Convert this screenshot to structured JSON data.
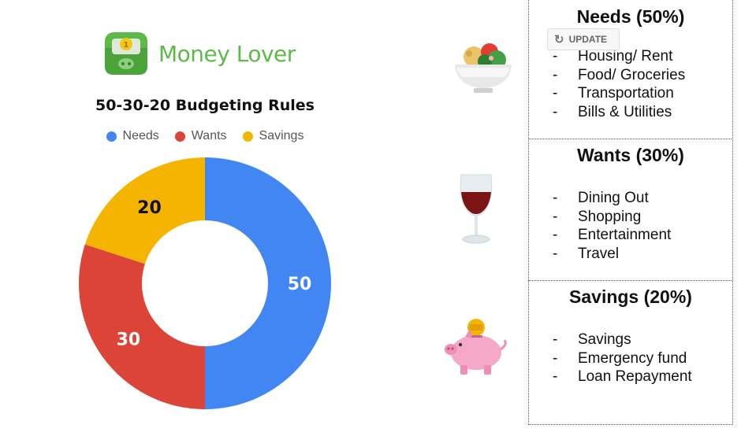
{
  "app": {
    "name": "Money Lover"
  },
  "update_button": {
    "label": "UPDATE",
    "icon": "refresh-icon"
  },
  "colors": {
    "needs": "#4286f4",
    "wants": "#db4437",
    "savings": "#f4b400",
    "brand": "#5dba4a"
  },
  "chart_data": {
    "type": "pie",
    "title": "50-30-20 Budgeting Rules",
    "donut": true,
    "legend_position": "top",
    "categories": [
      "Needs",
      "Wants",
      "Savings"
    ],
    "values": [
      50,
      30,
      20
    ],
    "data_labels": [
      "50",
      "30",
      "20"
    ]
  },
  "panels": [
    {
      "title": "Needs (50%)",
      "icon": "salad-bowl-icon",
      "items": [
        "Housing/ Rent",
        "Food/ Groceries",
        "Transportation",
        "Bills & Utilities"
      ]
    },
    {
      "title": "Wants (30%)",
      "icon": "wine-glass-icon",
      "items": [
        "Dining Out",
        "Shopping",
        "Entertainment",
        "Travel"
      ]
    },
    {
      "title": "Savings (20%)",
      "icon": "piggy-bank-icon",
      "items": [
        "Savings",
        "Emergency fund",
        "Loan Repayment"
      ]
    }
  ]
}
